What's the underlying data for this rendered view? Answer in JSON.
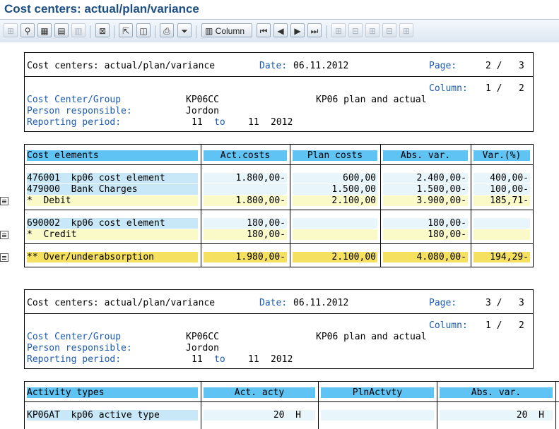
{
  "window": {
    "title": "Cost centers: actual/plan/variance"
  },
  "toolbar": {
    "column_label": "Column",
    "icons": [
      "hierarchy-icon",
      "find-icon",
      "grid-icon",
      "layout-icon",
      "info-icon",
      "export-icon",
      "select-icon",
      "columns-icon",
      "print-icon",
      "filter-icon",
      "column-icon",
      "first-page-icon",
      "prev-page-icon",
      "next-page-icon",
      "last-page-icon",
      "expand-icon",
      "collapse-icon",
      "expand-all-icon",
      "collapse-all-icon"
    ]
  },
  "page1": {
    "header": {
      "title": "Cost centers: actual/plan/variance",
      "date_label": "Date:",
      "date_value": "06.11.2012",
      "page_label": "Page:",
      "page_value": "2 /   3",
      "column_label": "Column:",
      "column_value": "1 /   2",
      "cost_center_label": "Cost Center/Group",
      "cost_center_value": "KP06CC",
      "cost_center_desc": "KP06 plan and actual",
      "person_label": "Person responsible:",
      "person_value": "Jordon",
      "period_label": "Reporting period:",
      "period_from": "11",
      "period_to_label": "to",
      "period_to": "11",
      "period_year": "2012"
    },
    "table": {
      "headers": [
        "Cost elements",
        "Act.costs",
        "Plan costs",
        "Abs. var.",
        "Var.(%)"
      ],
      "rows": [
        {
          "label": "476001  kp06 cost element",
          "act": "1.800,00-",
          "plan": "600,00",
          "abs": "2.400,00-",
          "var": "400,00-"
        },
        {
          "label": "479000  Bank Charges",
          "act": "",
          "plan": "1.500,00",
          "abs": "1.500,00-",
          "var": "100,00-"
        },
        {
          "label": "*  Debit",
          "act": "1.800,00-",
          "plan": "2.100,00",
          "abs": "3.900,00-",
          "var": "185,71-"
        },
        {
          "label": "690002  kp06 cost element",
          "act": "180,00-",
          "plan": "",
          "abs": "180,00-",
          "var": ""
        },
        {
          "label": "*  Credit",
          "act": "180,00-",
          "plan": "",
          "abs": "180,00-",
          "var": ""
        },
        {
          "label": "** Over/underabsorption",
          "act": "1.980,00-",
          "plan": "2.100,00",
          "abs": "4.080,00-",
          "var": "194,29-"
        }
      ]
    }
  },
  "page2": {
    "header": {
      "title": "Cost centers: actual/plan/variance",
      "date_label": "Date:",
      "date_value": "06.11.2012",
      "page_label": "Page:",
      "page_value": "3 /   3",
      "column_label": "Column:",
      "column_value": "1 /   2",
      "cost_center_label": "Cost Center/Group",
      "cost_center_value": "KP06CC",
      "cost_center_desc": "KP06 plan and actual",
      "person_label": "Person responsible:",
      "person_value": "Jordon",
      "period_label": "Reporting period:",
      "period_from": "11",
      "period_to_label": "to",
      "period_to": "11",
      "period_year": "2012"
    },
    "table": {
      "headers": [
        "Activity types",
        "Act. acty",
        "PlnActvty",
        "Abs. var."
      ],
      "rows": [
        {
          "label": "KP06AT  kp06 active type",
          "act": "20  H",
          "plan": "",
          "abs": "20  H"
        }
      ]
    }
  },
  "colors": {
    "header_cell": "#5fc3f3",
    "light_blue": "#c8e8f8",
    "light_yellow": "#fafac8",
    "dark_yellow": "#f5e060",
    "title_blue": "#1d4f86",
    "label_blue": "#1a5bb5"
  }
}
